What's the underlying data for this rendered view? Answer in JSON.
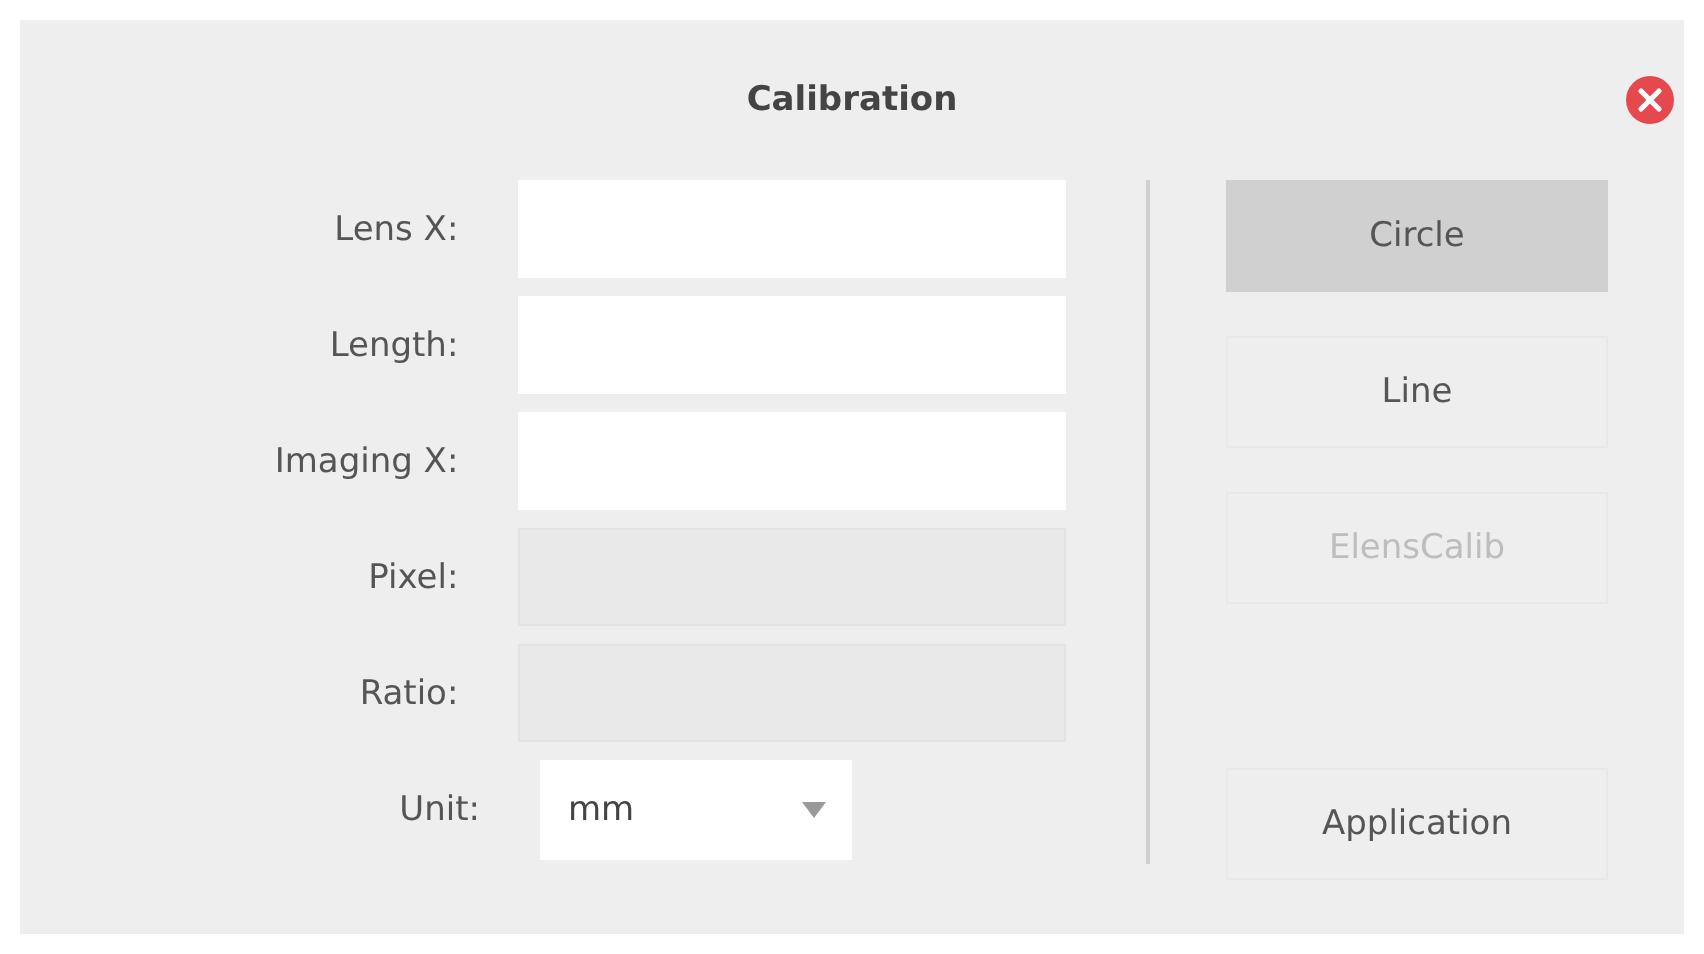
{
  "dialog": {
    "title": "Calibration"
  },
  "fields": [
    {
      "label": "Lens X:",
      "kind": "input",
      "disabled": false
    },
    {
      "label": "Length:",
      "kind": "input",
      "disabled": false
    },
    {
      "label": "Imaging X:",
      "kind": "input",
      "disabled": false
    },
    {
      "label": "Pixel:",
      "kind": "input",
      "disabled": true
    },
    {
      "label": "Ratio:",
      "kind": "input",
      "disabled": true
    },
    {
      "label": "Unit:",
      "kind": "select",
      "value": "mm",
      "disabled": false
    }
  ],
  "buttons": [
    {
      "label": "Circle",
      "selected": true,
      "disabled": false
    },
    {
      "label": "Line",
      "selected": false,
      "disabled": false
    },
    {
      "label": "ElensCalib",
      "selected": false,
      "disabled": true
    },
    {
      "label": "Application",
      "selected": false,
      "disabled": false
    }
  ]
}
